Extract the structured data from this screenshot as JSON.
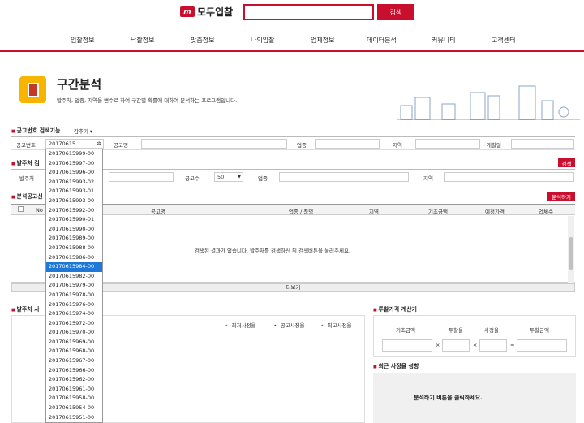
{
  "header": {
    "logo_mark": "m",
    "logo_text": "모두입찰",
    "search_placeholder": "",
    "search_button": "검색"
  },
  "nav": {
    "items": [
      "입찰정보",
      "낙찰정보",
      "맞춤정보",
      "나의입찰",
      "업체정보",
      "데이터분석",
      "커뮤니티",
      "고객센터"
    ]
  },
  "page": {
    "title": "구간분석",
    "description": "발주처, 업종, 지역을 변수로 하여 구간별 확률에 대하여 분석하는 프로그램입니다."
  },
  "section1": {
    "title": "공고번호 검색기능",
    "toggle": "감추기",
    "labels": {
      "notice_no": "공고번호",
      "notice_name": "공고명",
      "industry": "업종",
      "region": "지역",
      "open_date": "개찰일"
    },
    "notice_no_value": "20170615"
  },
  "section2": {
    "title": "발주처 검",
    "labels": {
      "client": "발주처",
      "count": "공고수",
      "industry": "업종",
      "region": "지역"
    },
    "count_value": "50",
    "search_button": "검색"
  },
  "section3": {
    "title": "분석공고선",
    "analyze_button": "분석하기",
    "columns": [
      "No",
      "공고명",
      "업종 / 품명",
      "지역",
      "기초금액",
      "예정가격",
      "업체수"
    ],
    "empty_message": "검색된 결과가 없습니다. 발주처를 검색하신 뒤 검색버튼을 눌러주세요.",
    "more": "더보기"
  },
  "section4": {
    "title": "발주처 사",
    "legend": [
      "최저사정율",
      "공고사정율",
      "최고사정율"
    ],
    "legend_colors": [
      "#2e9be0",
      "#c8102e",
      "#2a9d3a"
    ]
  },
  "calc": {
    "title": "투찰가격 계산기",
    "labels": [
      "기초금액",
      "투찰율",
      "사정율",
      "투찰금액"
    ],
    "ops": [
      "×",
      "×",
      "="
    ]
  },
  "trend": {
    "title": "최근 사정율 성향",
    "message": "분석하기 버튼을 클릭하세요."
  },
  "dropdown": {
    "items": [
      "20170615999-00",
      "20170615997-00",
      "20170615996-00",
      "20170615993-02",
      "20170615993-01",
      "20170615993-00",
      "20170615992-00",
      "20170615990-01",
      "20170615990-00",
      "20170615989-00",
      "20170615988-00",
      "20170615986-00",
      "20170615984-00",
      "20170615982-00",
      "20170615979-00",
      "20170615978-00",
      "20170615976-00",
      "20170615974-00",
      "20170615972-00",
      "20170615970-00",
      "20170615969-00",
      "20170615968-00",
      "20170615967-00",
      "20170615966-00",
      "20170615962-00",
      "20170615961-00",
      "20170615958-00",
      "20170615954-00",
      "20170615951-00"
    ],
    "selected_index": 12
  }
}
